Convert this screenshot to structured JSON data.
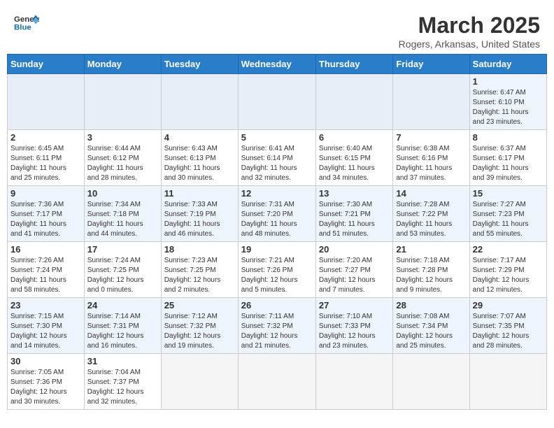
{
  "header": {
    "logo_general": "General",
    "logo_blue": "Blue",
    "month_title": "March 2025",
    "location": "Rogers, Arkansas, United States"
  },
  "weekdays": [
    "Sunday",
    "Monday",
    "Tuesday",
    "Wednesday",
    "Thursday",
    "Friday",
    "Saturday"
  ],
  "weeks": [
    [
      {
        "day": "",
        "info": ""
      },
      {
        "day": "",
        "info": ""
      },
      {
        "day": "",
        "info": ""
      },
      {
        "day": "",
        "info": ""
      },
      {
        "day": "",
        "info": ""
      },
      {
        "day": "",
        "info": ""
      },
      {
        "day": "1",
        "info": "Sunrise: 6:47 AM\nSunset: 6:10 PM\nDaylight: 11 hours\nand 23 minutes."
      }
    ],
    [
      {
        "day": "2",
        "info": "Sunrise: 6:45 AM\nSunset: 6:11 PM\nDaylight: 11 hours\nand 25 minutes."
      },
      {
        "day": "3",
        "info": "Sunrise: 6:44 AM\nSunset: 6:12 PM\nDaylight: 11 hours\nand 28 minutes."
      },
      {
        "day": "4",
        "info": "Sunrise: 6:43 AM\nSunset: 6:13 PM\nDaylight: 11 hours\nand 30 minutes."
      },
      {
        "day": "5",
        "info": "Sunrise: 6:41 AM\nSunset: 6:14 PM\nDaylight: 11 hours\nand 32 minutes."
      },
      {
        "day": "6",
        "info": "Sunrise: 6:40 AM\nSunset: 6:15 PM\nDaylight: 11 hours\nand 34 minutes."
      },
      {
        "day": "7",
        "info": "Sunrise: 6:38 AM\nSunset: 6:16 PM\nDaylight: 11 hours\nand 37 minutes."
      },
      {
        "day": "8",
        "info": "Sunrise: 6:37 AM\nSunset: 6:17 PM\nDaylight: 11 hours\nand 39 minutes."
      }
    ],
    [
      {
        "day": "9",
        "info": "Sunrise: 7:36 AM\nSunset: 7:17 PM\nDaylight: 11 hours\nand 41 minutes."
      },
      {
        "day": "10",
        "info": "Sunrise: 7:34 AM\nSunset: 7:18 PM\nDaylight: 11 hours\nand 44 minutes."
      },
      {
        "day": "11",
        "info": "Sunrise: 7:33 AM\nSunset: 7:19 PM\nDaylight: 11 hours\nand 46 minutes."
      },
      {
        "day": "12",
        "info": "Sunrise: 7:31 AM\nSunset: 7:20 PM\nDaylight: 11 hours\nand 48 minutes."
      },
      {
        "day": "13",
        "info": "Sunrise: 7:30 AM\nSunset: 7:21 PM\nDaylight: 11 hours\nand 51 minutes."
      },
      {
        "day": "14",
        "info": "Sunrise: 7:28 AM\nSunset: 7:22 PM\nDaylight: 11 hours\nand 53 minutes."
      },
      {
        "day": "15",
        "info": "Sunrise: 7:27 AM\nSunset: 7:23 PM\nDaylight: 11 hours\nand 55 minutes."
      }
    ],
    [
      {
        "day": "16",
        "info": "Sunrise: 7:26 AM\nSunset: 7:24 PM\nDaylight: 11 hours\nand 58 minutes."
      },
      {
        "day": "17",
        "info": "Sunrise: 7:24 AM\nSunset: 7:25 PM\nDaylight: 12 hours\nand 0 minutes."
      },
      {
        "day": "18",
        "info": "Sunrise: 7:23 AM\nSunset: 7:25 PM\nDaylight: 12 hours\nand 2 minutes."
      },
      {
        "day": "19",
        "info": "Sunrise: 7:21 AM\nSunset: 7:26 PM\nDaylight: 12 hours\nand 5 minutes."
      },
      {
        "day": "20",
        "info": "Sunrise: 7:20 AM\nSunset: 7:27 PM\nDaylight: 12 hours\nand 7 minutes."
      },
      {
        "day": "21",
        "info": "Sunrise: 7:18 AM\nSunset: 7:28 PM\nDaylight: 12 hours\nand 9 minutes."
      },
      {
        "day": "22",
        "info": "Sunrise: 7:17 AM\nSunset: 7:29 PM\nDaylight: 12 hours\nand 12 minutes."
      }
    ],
    [
      {
        "day": "23",
        "info": "Sunrise: 7:15 AM\nSunset: 7:30 PM\nDaylight: 12 hours\nand 14 minutes."
      },
      {
        "day": "24",
        "info": "Sunrise: 7:14 AM\nSunset: 7:31 PM\nDaylight: 12 hours\nand 16 minutes."
      },
      {
        "day": "25",
        "info": "Sunrise: 7:12 AM\nSunset: 7:32 PM\nDaylight: 12 hours\nand 19 minutes."
      },
      {
        "day": "26",
        "info": "Sunrise: 7:11 AM\nSunset: 7:32 PM\nDaylight: 12 hours\nand 21 minutes."
      },
      {
        "day": "27",
        "info": "Sunrise: 7:10 AM\nSunset: 7:33 PM\nDaylight: 12 hours\nand 23 minutes."
      },
      {
        "day": "28",
        "info": "Sunrise: 7:08 AM\nSunset: 7:34 PM\nDaylight: 12 hours\nand 25 minutes."
      },
      {
        "day": "29",
        "info": "Sunrise: 7:07 AM\nSunset: 7:35 PM\nDaylight: 12 hours\nand 28 minutes."
      }
    ],
    [
      {
        "day": "30",
        "info": "Sunrise: 7:05 AM\nSunset: 7:36 PM\nDaylight: 12 hours\nand 30 minutes."
      },
      {
        "day": "31",
        "info": "Sunrise: 7:04 AM\nSunset: 7:37 PM\nDaylight: 12 hours\nand 32 minutes."
      },
      {
        "day": "",
        "info": ""
      },
      {
        "day": "",
        "info": ""
      },
      {
        "day": "",
        "info": ""
      },
      {
        "day": "",
        "info": ""
      },
      {
        "day": "",
        "info": ""
      }
    ]
  ]
}
